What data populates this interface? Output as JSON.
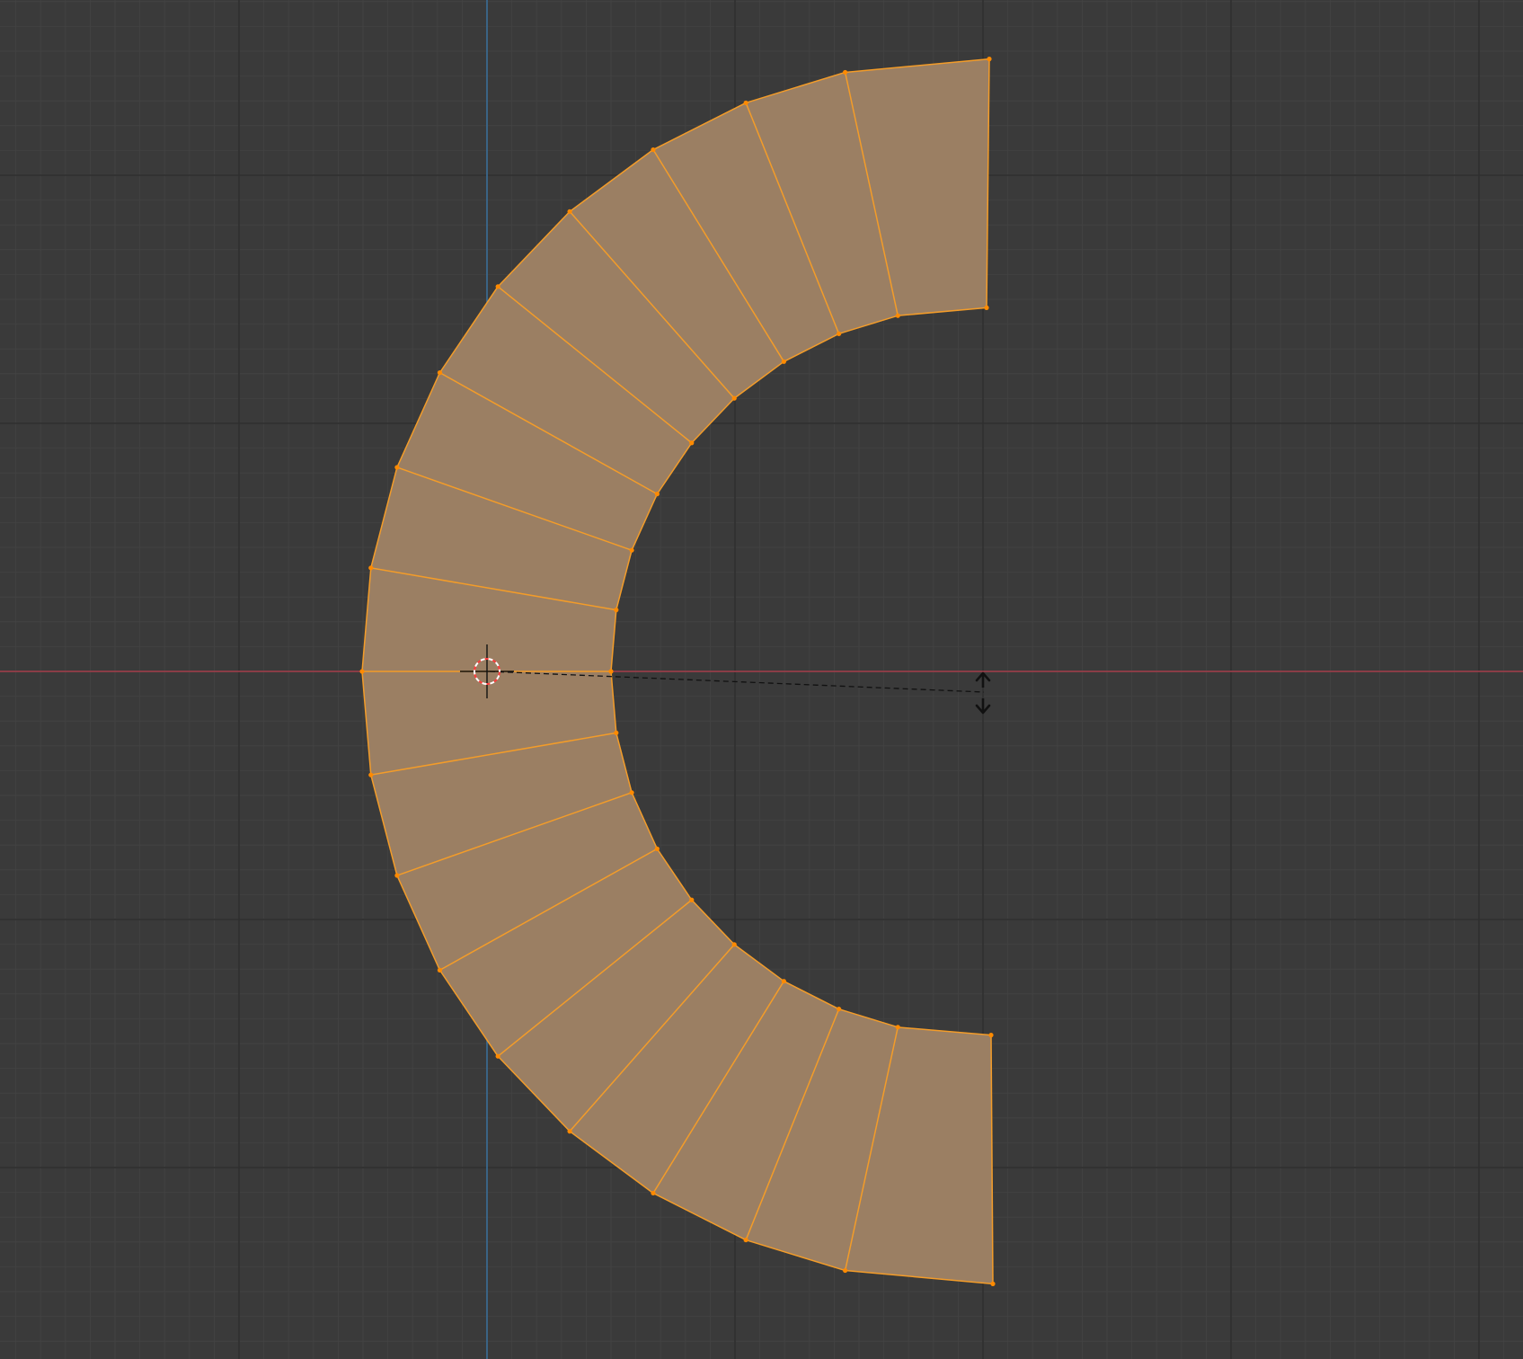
{
  "viewport": {
    "mode": "top-orthographic",
    "background_color": "#3a3a3a",
    "grid_minor_color": "#424242",
    "grid_major_color": "#2f2f2f",
    "x_axis_color": "#a6404c",
    "y_axis_color": "#3d78a8"
  },
  "mesh": {
    "name": "c-shaped-arc-mesh",
    "selected": true,
    "face_color": "#9b7f63",
    "edge_color": "#f39c29",
    "vertex_color": "#ff8a00",
    "segments": 18
  },
  "cursor": {
    "icon": "3d-cursor-icon",
    "ring_color_a": "#ff3c3c",
    "ring_color_b": "#ffffff"
  },
  "transform_gizmo": {
    "icon": "vertical-scale-arrows-icon",
    "line_color": "#111111"
  }
}
